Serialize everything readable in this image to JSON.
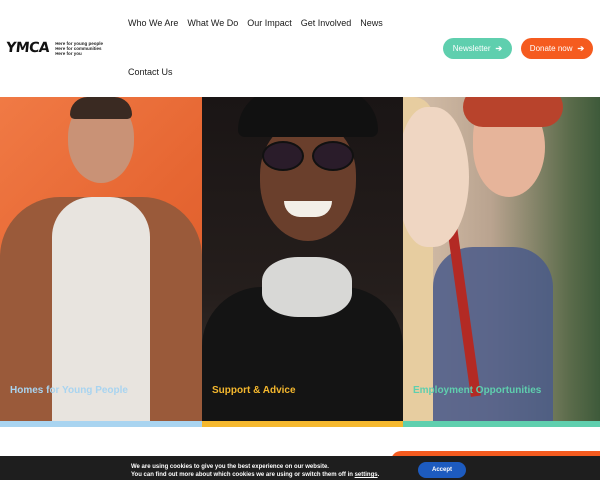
{
  "brand": {
    "logo_text": "YMCA",
    "tagline": [
      "Here for young people",
      "Here for communities",
      "Here for you"
    ]
  },
  "nav": {
    "items": [
      "Who We Are",
      "What We Do",
      "Our Impact",
      "Get Involved",
      "News",
      "Contact Us"
    ]
  },
  "buttons": {
    "newsletter": "Newsletter",
    "donate": "Donate now",
    "arrow_icon": "arrow-right-icon"
  },
  "panels": [
    {
      "label": "Homes for Young People",
      "accent": "#a9d4f0"
    },
    {
      "label": "Support & Advice",
      "accent": "#f5b82e"
    },
    {
      "label": "Employment Opportunities",
      "accent": "#5fcfae"
    }
  ],
  "cookie": {
    "line1": "We are using cookies to give you the best experience on our website.",
    "line2_prefix": "You can find out more about which cookies we are using or switch them off in",
    "link": "settings",
    "line2_suffix": ".",
    "accept": "Accept"
  },
  "colors": {
    "newsletter": "#5fcfae",
    "donate": "#f55b1f",
    "accept": "#1d5bbf"
  }
}
